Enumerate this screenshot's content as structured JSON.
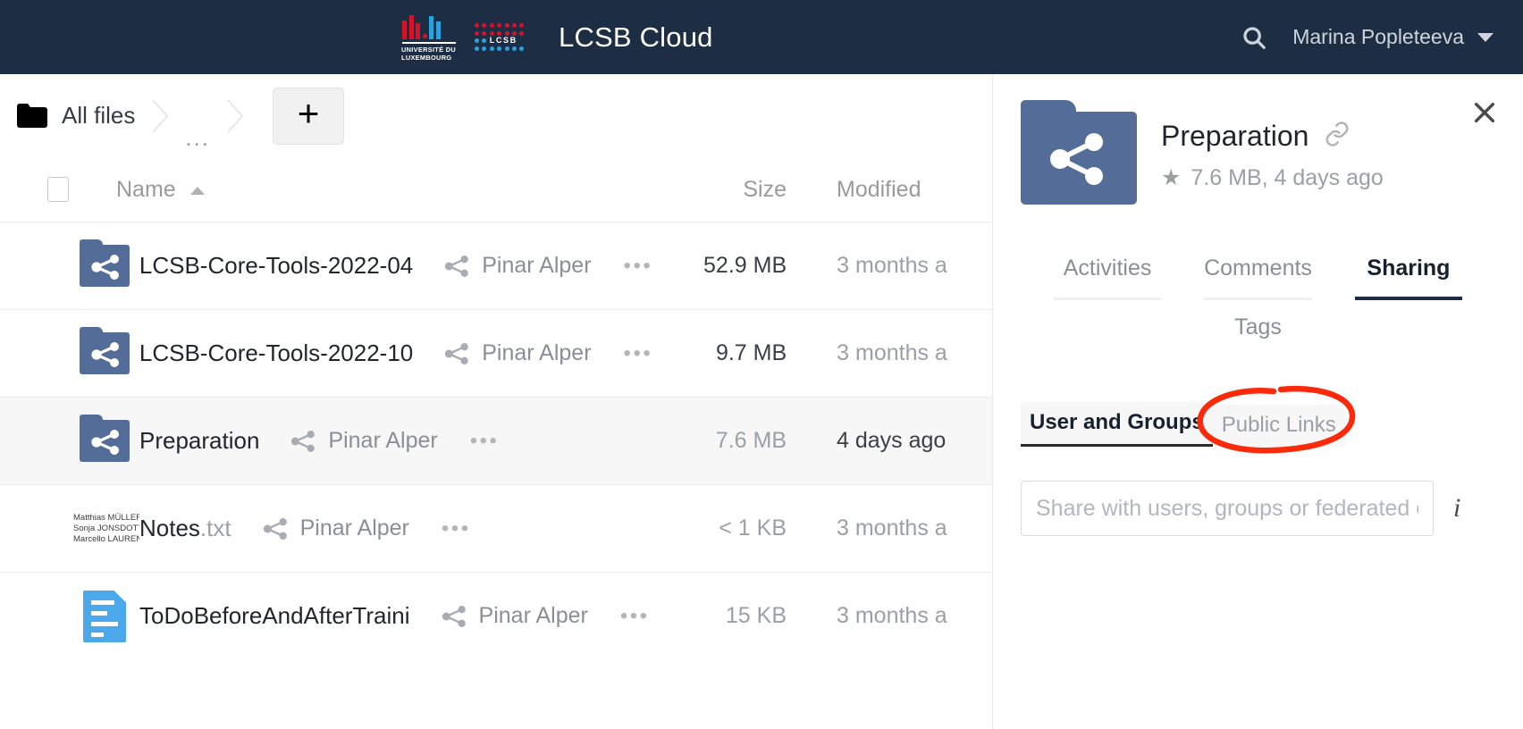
{
  "header": {
    "app_title": "LCSB Cloud",
    "university_line1": "UNIVERSITÉ DU",
    "university_line2": "LUXEMBOURG",
    "lcsb_word": "LCSB",
    "search_icon": "search-icon",
    "user_name": "Marina Popleteeva",
    "caret_icon": "chevron-down-icon",
    "bg_color": "#1d2d44"
  },
  "breadcrumb": {
    "home_icon": "folder-icon",
    "home_label": "All files",
    "ellipsis": "...",
    "new_button_label": "+"
  },
  "table": {
    "columns": {
      "name": "Name",
      "size": "Size",
      "modified": "Modified"
    },
    "sort_indicator": "ascending",
    "rows": [
      {
        "icon": "shared-folder-icon",
        "name": "LCSB-Core-Tools-2022-04",
        "ext": "",
        "shared_by": "Pinar Alper",
        "actions": "•••",
        "size": "52.9 MB",
        "modified": "3 months a",
        "selected": false,
        "size_dim": false,
        "mod_dark": false
      },
      {
        "icon": "shared-folder-icon",
        "name": "LCSB-Core-Tools-2022-10",
        "ext": "",
        "shared_by": "Pinar Alper",
        "actions": "•••",
        "size": "9.7 MB",
        "modified": "3 months a",
        "selected": false,
        "size_dim": false,
        "mod_dark": false
      },
      {
        "icon": "shared-folder-icon",
        "name": "Preparation",
        "ext": "",
        "shared_by": "Pinar Alper",
        "actions": "•••",
        "size": "7.6 MB",
        "modified": "4 days ago",
        "selected": true,
        "size_dim": true,
        "mod_dark": true
      },
      {
        "icon": "text-preview-thumbnail",
        "name": "Notes",
        "ext": ".txt",
        "shared_by": "Pinar Alper",
        "actions": "•••",
        "size": "< 1 KB",
        "modified": "3 months a",
        "selected": false,
        "size_dim": true,
        "mod_dark": false
      },
      {
        "icon": "document-icon",
        "name": "ToDoBeforeAndAfterTraini",
        "ext": "",
        "shared_by": "Pinar Alper",
        "actions": "•••",
        "size": "15 KB",
        "modified": "3 months a",
        "selected": false,
        "size_dim": true,
        "mod_dark": false
      }
    ],
    "thumbnail_lines": [
      "Matthias MÜLLER",
      "Sonja JONSDOTTI",
      "Marcello LAUREN"
    ]
  },
  "sidebar": {
    "close_icon": "close-icon",
    "file_icon": "shared-folder-icon",
    "title": "Preparation",
    "link_icon": "link-icon",
    "favorite_icon": "star-icon",
    "meta": "7.6 MB, 4 days ago",
    "tabs": [
      {
        "label": "Activities",
        "active": false
      },
      {
        "label": "Comments",
        "active": false
      },
      {
        "label": "Sharing",
        "active": true
      },
      {
        "label": "Tags",
        "active": false
      }
    ],
    "subtabs": [
      {
        "label": "User and Groups",
        "active": true
      },
      {
        "label": "Public Links",
        "active": false,
        "annotated": true
      }
    ],
    "share_input_placeholder": "Share with users, groups or federated cloud ID",
    "share_input_value": "",
    "info_icon": "info-icon",
    "annotation_color": "#fb2a0b"
  }
}
